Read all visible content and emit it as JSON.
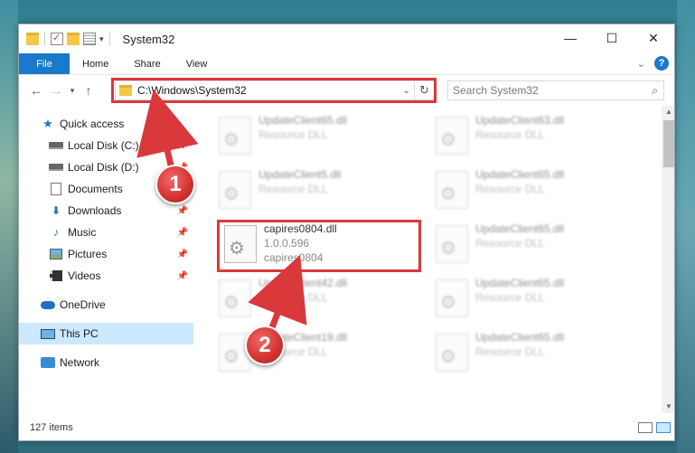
{
  "window": {
    "title": "System32"
  },
  "ribbon": {
    "tabs": [
      "File",
      "Home",
      "Share",
      "View"
    ],
    "help": "?"
  },
  "nav": {
    "address": "C:\\Windows\\System32",
    "search_placeholder": "Search System32"
  },
  "sidebar": {
    "items": [
      {
        "label": "Quick access",
        "icon": "star-icon",
        "pinned": false
      },
      {
        "label": "Local Disk (C:)",
        "icon": "drive-icon",
        "pinned": true
      },
      {
        "label": "Local Disk (D:)",
        "icon": "drive-icon",
        "pinned": true
      },
      {
        "label": "Documents",
        "icon": "document-icon",
        "pinned": true
      },
      {
        "label": "Downloads",
        "icon": "download-icon",
        "pinned": true
      },
      {
        "label": "Music",
        "icon": "music-icon",
        "pinned": true
      },
      {
        "label": "Pictures",
        "icon": "pictures-icon",
        "pinned": true
      },
      {
        "label": "Videos",
        "icon": "videos-icon",
        "pinned": true
      },
      {
        "label": "OneDrive",
        "icon": "cloud-icon"
      },
      {
        "label": "This PC",
        "icon": "computer-icon",
        "selected": true
      },
      {
        "label": "Network",
        "icon": "network-icon"
      }
    ]
  },
  "files": {
    "highlighted": {
      "name": "capires0804.dll",
      "version": "1.0.0.596",
      "description": "capires0804"
    },
    "blurred": [
      {
        "name": "UpdateClient65.dll",
        "sub": "Resource DLL"
      },
      {
        "name": "UpdateClient63.dll",
        "sub": "Resource DLL"
      },
      {
        "name": "UpdateClient5.dll",
        "sub": "Resource DLL"
      },
      {
        "name": "UpdateClient65.dll",
        "sub": "Resource DLL"
      },
      {
        "name": "UpdateClient65.dll",
        "sub": "Resource DLL"
      },
      {
        "name": "UpdateClient42.dll",
        "sub": "Resource DLL"
      },
      {
        "name": "UpdateClient65.dll",
        "sub": "Resource DLL"
      },
      {
        "name": "UpdateClient19.dll",
        "sub": "Resource DLL"
      },
      {
        "name": "UpdateClient65.dll",
        "sub": "Resource DLL"
      }
    ]
  },
  "status": {
    "count": "127 items"
  },
  "callouts": {
    "one": "1",
    "two": "2"
  },
  "colors": {
    "accent": "#1979ca",
    "highlight": "#d9393b",
    "selected": "#cce8ff"
  }
}
